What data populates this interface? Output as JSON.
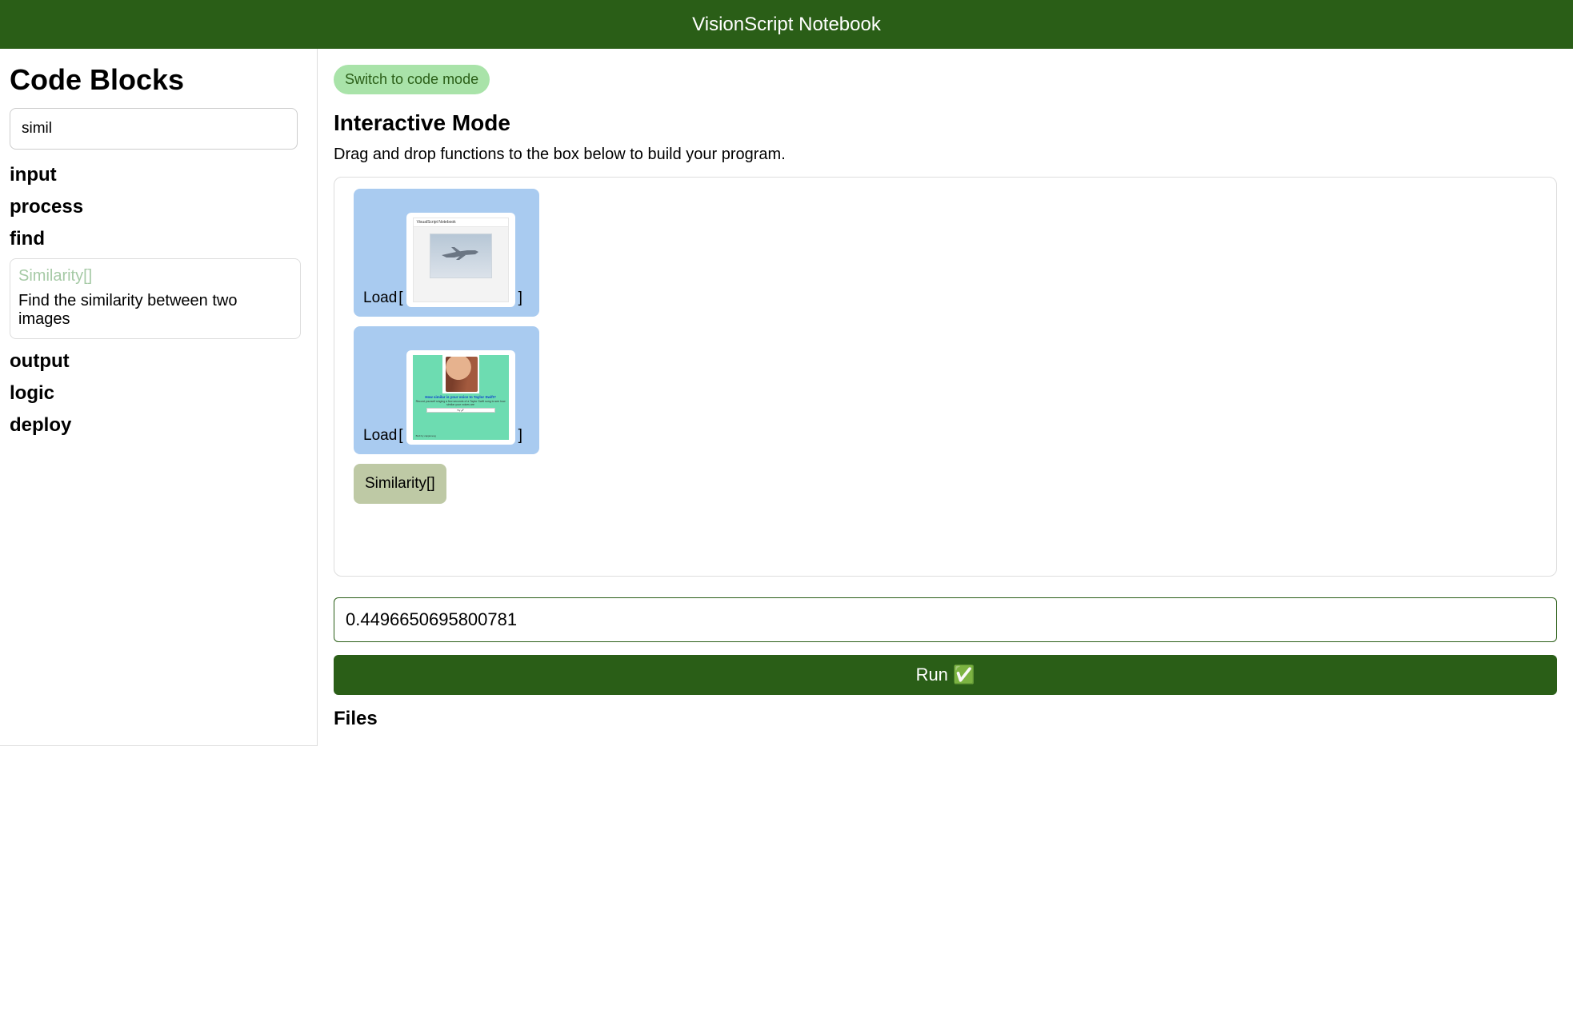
{
  "header": {
    "title": "VisionScript Notebook"
  },
  "sidebar": {
    "title": "Code Blocks",
    "search_value": "simil",
    "categories": {
      "input": "input",
      "process": "process",
      "find": "find",
      "output": "output",
      "logic": "logic",
      "deploy": "deploy"
    },
    "block": {
      "name": "Similarity[]",
      "description": "Find the similarity between two images"
    }
  },
  "main": {
    "switch_label": "Switch to code mode",
    "mode_title": "Interactive Mode",
    "instructions": "Drag and drop functions to the box below to build your program.",
    "load1": {
      "label": "Load",
      "open": "[",
      "close": "]"
    },
    "load2": {
      "label": "Load",
      "open": "[",
      "close": "]"
    },
    "similarity_label": "Similarity[]",
    "output_value": "0.4496650695800781",
    "run_label": "Run ✅",
    "files_label": "Files"
  }
}
